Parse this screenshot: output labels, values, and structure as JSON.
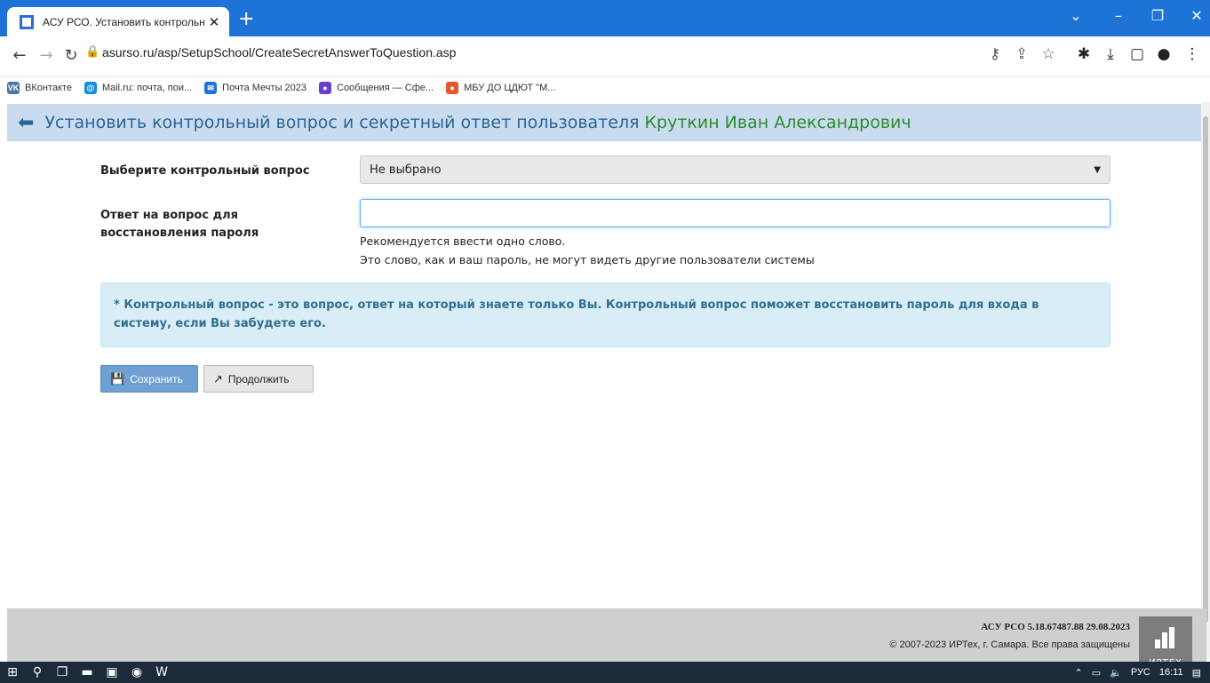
{
  "browser": {
    "tab_title": "АСУ РСО. Установить контрольн",
    "tab_close": "✕",
    "new_tab": "+",
    "url": "asurso.ru/asp/SetupSchool/CreateSecretAnswerToQuestion.asp",
    "bookmarks": [
      {
        "label": "ВКонтакте",
        "icon": "vk-icon",
        "color": "#4a76a8",
        "glyph": "VK"
      },
      {
        "label": "Mail.ru: почта, пои...",
        "icon": "mailru-icon",
        "color": "#168de2",
        "glyph": "@"
      },
      {
        "label": "Почта Мечты 2023",
        "icon": "mail-icon",
        "color": "#1e73d6",
        "glyph": "✉"
      },
      {
        "label": "Сообщения — Сфе...",
        "icon": "sphere-icon",
        "color": "#6a3fd6",
        "glyph": "●"
      },
      {
        "label": "МБУ ДО ЦДЮТ \"М...",
        "icon": "cdyut-icon",
        "color": "#e2582c",
        "glyph": "●"
      }
    ]
  },
  "page": {
    "heading": "Установить контрольный вопрос и секретный ответ пользователя",
    "user_name": "Круткин Иван Александрович",
    "question_label": "Выберите контрольный вопрос",
    "question_value": "Не выбрано",
    "answer_label": "Ответ на вопрос для восстановления пароля",
    "answer_value": "",
    "hint_1": "Рекомендуется ввести одно слово.",
    "hint_2": "Это слово, как и ваш пароль, не могут видеть другие пользователи системы",
    "info_text": "* Контрольный вопрос - это вопрос, ответ на который знаете только Вы. Контрольный вопрос поможет восстановить пароль для входа в систему, если Вы забудете его.",
    "save_label": "Сохранить",
    "continue_label": "Продолжить"
  },
  "footer": {
    "version": "АСУ РСО  5.18.67487.88  29.08.2023",
    "copyright": "© 2007-2023 ИРТех, г. Самара. Все права защищены",
    "logo_text": "ИРТЕХ"
  },
  "taskbar": {
    "language": "РУС",
    "time": "16:11"
  },
  "colors": {
    "tab_strip": "#1e73d6",
    "header_bg": "#c9dcef",
    "heading_text": "#2a6496",
    "user_name_text": "#2e8b2e",
    "info_bg": "#d9edf7"
  }
}
